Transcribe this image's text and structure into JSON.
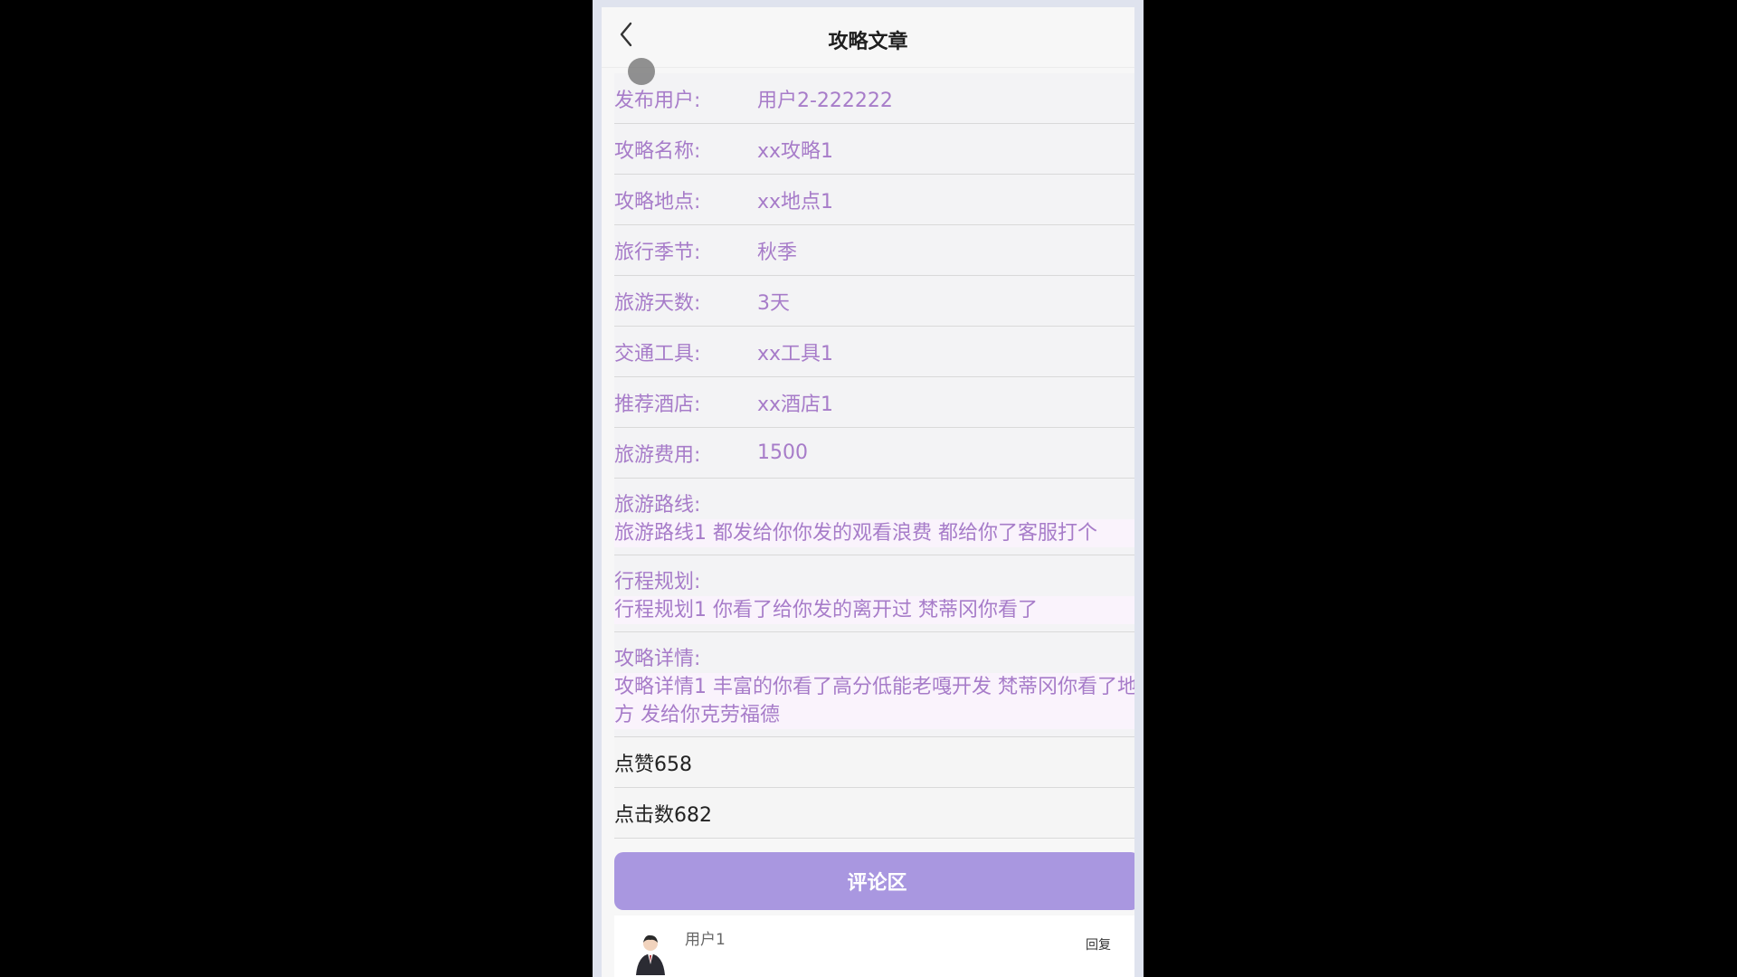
{
  "header": {
    "title": "攻略文章"
  },
  "fields": [
    {
      "label": "发布用户:",
      "value": "用户2-222222"
    },
    {
      "label": "攻略名称:",
      "value": "xx攻略1"
    },
    {
      "label": "攻略地点:",
      "value": "xx地点1"
    },
    {
      "label": "旅行季节:",
      "value": "秋季"
    },
    {
      "label": "旅游天数:",
      "value": "3天"
    },
    {
      "label": "交通工具:",
      "value": "xx工具1"
    },
    {
      "label": "推荐酒店:",
      "value": "xx酒店1"
    },
    {
      "label": "旅游费用:",
      "value": "1500"
    }
  ],
  "blocks": [
    {
      "label": "旅游路线:",
      "value": "旅游路线1 都发给你你发的观看浪费 都给你了客服打个"
    },
    {
      "label": "行程规划:",
      "value": "行程规划1 你看了给你发的离开过 梵蒂冈你看了"
    },
    {
      "label": "攻略详情:",
      "value": "攻略详情1 丰富的你看了高分低能老嘎开发 梵蒂冈你看了地方 发给你克劳福德"
    }
  ],
  "stats": {
    "likes": "点赞658",
    "clicks": "点击数682"
  },
  "comments": {
    "section_label": "评论区",
    "items": [
      {
        "user": "用户1",
        "reply_label": "回复"
      }
    ]
  },
  "colors": {
    "accent": "#a997e0",
    "field_text": "#a77cc9"
  },
  "icons": {
    "back": "chevron-left-icon"
  }
}
